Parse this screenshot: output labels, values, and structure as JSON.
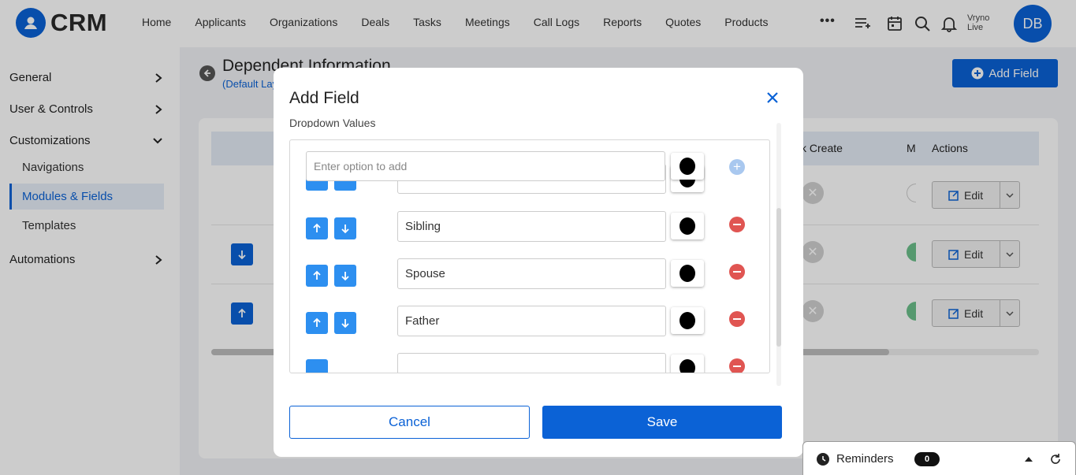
{
  "brand": {
    "name": "CRM"
  },
  "nav": {
    "items": [
      "Home",
      "Applicants",
      "Organizations",
      "Deals",
      "Tasks",
      "Meetings",
      "Call Logs",
      "Reports",
      "Quotes",
      "Products"
    ],
    "more": "•••",
    "user_line1": "Vryno",
    "user_line2": "Live",
    "avatar_initials": "DB"
  },
  "sidebar": {
    "general": "General",
    "user_controls": "User & Controls",
    "customizations": "Customizations",
    "navigations": "Navigations",
    "modules_fields": "Modules & Fields",
    "templates": "Templates",
    "automations": "Automations"
  },
  "page": {
    "title": "Dependent Information",
    "subtitle": "(Default Layout)",
    "add_field_button": "Add Field"
  },
  "table": {
    "header_quick_create": "k Create",
    "header_m": "M",
    "header_actions": "Actions",
    "edit_label": "Edit"
  },
  "modal": {
    "title": "Add Field",
    "section_label": "Dropdown Values",
    "option_placeholder": "Enter option to add",
    "values": [
      "Sibling",
      "Spouse",
      "Father"
    ],
    "cancel_label": "Cancel",
    "save_label": "Save"
  },
  "reminders": {
    "label": "Reminders",
    "count": "0"
  },
  "colors": {
    "primary": "#0b62d6",
    "arrow_button": "#2d8ff0",
    "remove": "#e05552",
    "add_disabled": "#a9c8ef"
  }
}
